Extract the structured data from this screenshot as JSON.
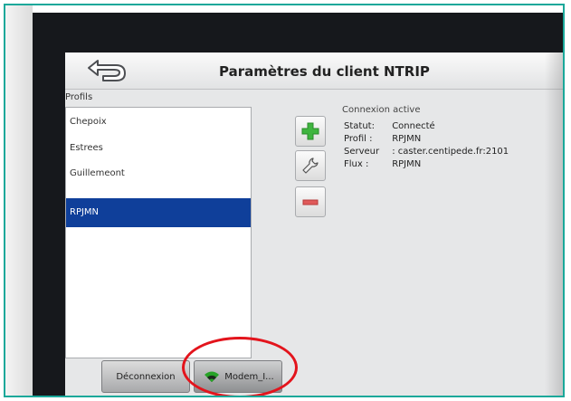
{
  "window": {
    "title": "Paramètres du client NTRIP"
  },
  "profiles": {
    "label": "Profils",
    "items": [
      {
        "label": "Chepoix",
        "selected": false
      },
      {
        "label": "Estrees",
        "selected": false
      },
      {
        "label": "Guillemeont",
        "selected": false
      },
      {
        "label": "RPJMN",
        "selected": true
      }
    ]
  },
  "toolbar": {
    "add_icon": "plus-icon",
    "edit_icon": "wrench-icon",
    "remove_icon": "minus-icon"
  },
  "connection": {
    "title": "Connexion active",
    "rows": [
      {
        "key": "Statut:",
        "value": "Connecté"
      },
      {
        "key": "Profil  :",
        "value": "RPJMN"
      },
      {
        "key": "Serveur",
        "value": ": caster.centipede.fr:2101"
      },
      {
        "key": "Flux   :",
        "value": "RPJMN"
      }
    ]
  },
  "bottom": {
    "disconnect_label": "Déconnexion",
    "modem_label": "Modem_I..."
  },
  "colors": {
    "selected_row": "#0f3f9a",
    "plus_green": "#3fb53f",
    "minus_red": "#e05a5a",
    "highlight_oval": "#e3141c",
    "frame_teal": "#1aa89a"
  }
}
